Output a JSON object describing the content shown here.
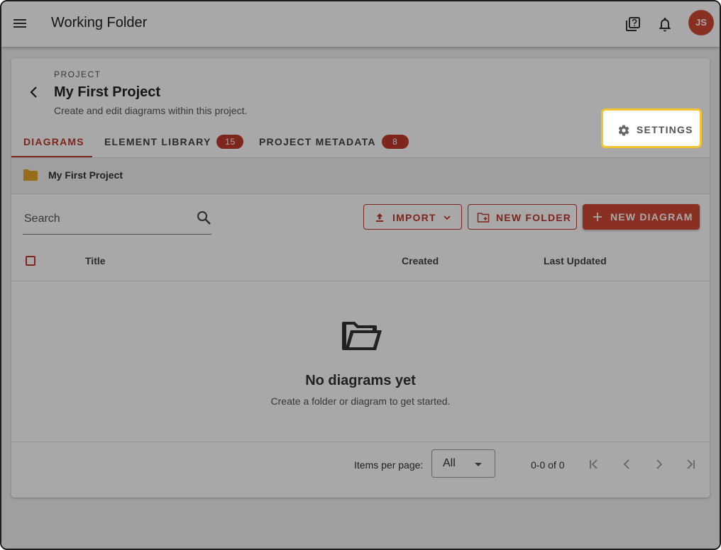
{
  "appbar": {
    "title": "Working Folder",
    "avatar_initials": "JS",
    "avatar_color": "#d24a35"
  },
  "project": {
    "overline": "PROJECT",
    "title": "My First Project",
    "subtitle": "Create and edit diagrams within this project."
  },
  "tabs": [
    {
      "label": "DIAGRAMS",
      "active": true
    },
    {
      "label": "ELEMENT LIBRARY",
      "badge": "15"
    },
    {
      "label": "PROJECT METADATA",
      "badge": "8"
    }
  ],
  "settings": {
    "label": "SETTINGS",
    "highlight_color": "#f3c42c"
  },
  "breadcrumb": {
    "label": "My First Project"
  },
  "search": {
    "placeholder": "Search"
  },
  "actions": {
    "import_label": "IMPORT",
    "new_folder_label": "NEW FOLDER",
    "new_diagram_label": "NEW DIAGRAM"
  },
  "table": {
    "columns": [
      "Title",
      "Created",
      "Last Updated"
    ]
  },
  "empty_state": {
    "title": "No diagrams yet",
    "subtitle": "Create a folder or diagram to get started."
  },
  "pagination": {
    "items_per_page_label": "Items per page:",
    "items_per_page_value": "All",
    "range": "0-0 of 0"
  },
  "colors": {
    "accent": "#c0392b",
    "folder": "#e6a62a"
  },
  "icons": [
    "menu-icon",
    "help-icon",
    "bell-icon",
    "back-arrow-icon",
    "gear-icon",
    "folder-icon",
    "search-icon",
    "upload-icon",
    "chevron-down-icon",
    "new-folder-icon",
    "plus-icon",
    "open-folder-icon",
    "first-page-icon",
    "prev-page-icon",
    "next-page-icon",
    "last-page-icon"
  ]
}
